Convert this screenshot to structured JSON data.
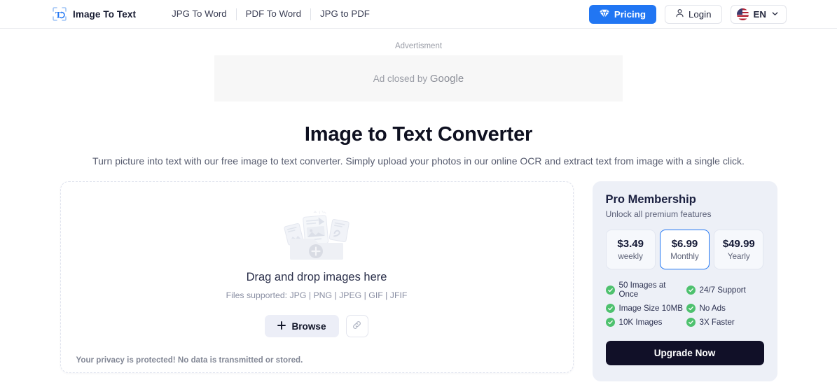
{
  "header": {
    "logo_icon": "text-scan-icon",
    "brand": "Image To Text",
    "nav": [
      {
        "label": "JPG To Word"
      },
      {
        "label": "PDF To Word"
      },
      {
        "label": "JPG to PDF"
      }
    ],
    "pricing_label": "Pricing",
    "pricing_icon": "diamond-icon",
    "login_label": "Login",
    "login_icon": "user-icon",
    "language": "EN",
    "language_icon": "us-flag-icon",
    "chevron_icon": "chevron-down-icon",
    "accent_color": "#2176f3"
  },
  "ad": {
    "label": "Advertisment",
    "closed_text": "Ad closed by ",
    "brand": "Google"
  },
  "hero": {
    "title": "Image to Text Converter",
    "subtitle": "Turn picture into text with our free image to text converter. Simply upload your photos in our online OCR and extract text from image with a single click."
  },
  "dropzone": {
    "illustration_icon": "file-upload-illustration",
    "title": "Drag and drop images here",
    "supported": "Files supported: JPG | PNG | JPEG | GIF | JFIF",
    "browse_label": "Browse",
    "plus_icon": "plus-icon",
    "link_icon": "link-icon",
    "privacy": "Your privacy is protected! No data is transmitted or stored."
  },
  "pro": {
    "title": "Pro Membership",
    "subtitle": "Unlock all premium features",
    "tiers": [
      {
        "price": "$3.49",
        "period": "weekly",
        "selected": false
      },
      {
        "price": "$6.99",
        "period": "Monthly",
        "selected": true
      },
      {
        "price": "$49.99",
        "period": "Yearly",
        "selected": false
      }
    ],
    "features": [
      {
        "label": "50 Images at Once"
      },
      {
        "label": "24/7 Support"
      },
      {
        "label": "Image Size 10MB"
      },
      {
        "label": "No Ads"
      },
      {
        "label": "10K Images"
      },
      {
        "label": "3X Faster"
      }
    ],
    "check_icon": "check-circle-icon",
    "check_color": "#4ec16e",
    "upgrade_label": "Upgrade Now",
    "panel_color": "#edf0f7",
    "upgrade_color": "#111028"
  }
}
